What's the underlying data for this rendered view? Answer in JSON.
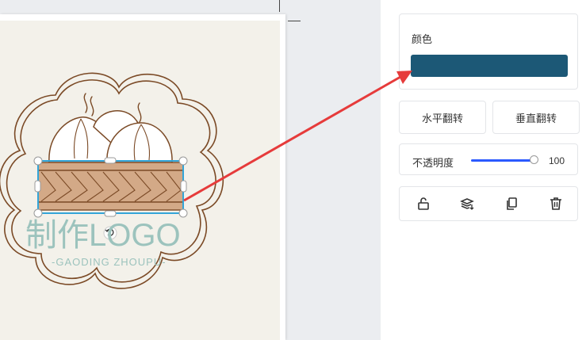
{
  "colors": {
    "selected_fill": "#1c5876",
    "arrow": "#e63b3b",
    "logo_text": "#9cc3bd",
    "logo_outline": "#7b4a26",
    "steamer_fill": "#d3a987",
    "selection": "#33a5d8"
  },
  "logo": {
    "main_text": "制作LOGO",
    "sub_text": "-GAODING ZHOUPU-"
  },
  "panel": {
    "color_label": "颜色",
    "flip_horizontal_label": "水平翻转",
    "flip_vertical_label": "垂直翻转",
    "opacity_label": "不透明度",
    "opacity_value": "100",
    "opacity_level": 1.0,
    "tools": [
      "unlock-icon",
      "layers-icon",
      "copy-icon",
      "delete-icon"
    ]
  }
}
